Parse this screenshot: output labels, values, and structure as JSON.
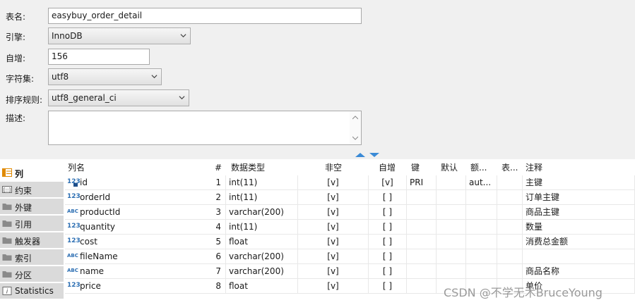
{
  "form": {
    "table_name_label": "表名:",
    "table_name_value": "easybuy_order_detail",
    "engine_label": "引擎:",
    "engine_value": "InnoDB",
    "auto_inc_label": "自增:",
    "auto_inc_value": "156",
    "charset_label": "字符集:",
    "charset_value": "utf8",
    "collation_label": "排序规则:",
    "collation_value": "utf8_general_ci",
    "description_label": "描述:",
    "description_value": ""
  },
  "side_tabs": [
    {
      "label": "列",
      "icon": "columns-icon",
      "active": true
    },
    {
      "label": "约束",
      "icon": "constraint-icon",
      "active": false
    },
    {
      "label": "外键",
      "icon": "folder-icon",
      "active": false
    },
    {
      "label": "引用",
      "icon": "folder-icon",
      "active": false
    },
    {
      "label": "触发器",
      "icon": "folder-icon",
      "active": false
    },
    {
      "label": "索引",
      "icon": "folder-icon",
      "active": false
    },
    {
      "label": "分区",
      "icon": "folder-icon",
      "active": false
    },
    {
      "label": "Statistics",
      "icon": "info-icon",
      "active": false
    }
  ],
  "grid": {
    "headers": {
      "name": "列名",
      "num": "#",
      "type": "数据类型",
      "notnull": "非空",
      "autoinc": "自增",
      "key": "键",
      "default": "默认",
      "extra": "额...",
      "expr": "表...",
      "comment": "注释"
    },
    "rows": [
      {
        "icon": "123",
        "name": "id",
        "num": "1",
        "type": "int(11)",
        "notnull": "[v]",
        "autoinc": "[v]",
        "key": "PRI",
        "default": "",
        "extra": "aut...",
        "expr": "",
        "comment": "主键",
        "pk": true
      },
      {
        "icon": "123",
        "name": "orderId",
        "num": "2",
        "type": "int(11)",
        "notnull": "[v]",
        "autoinc": "[ ]",
        "key": "",
        "default": "",
        "extra": "",
        "expr": "",
        "comment": "订单主键",
        "pk": false
      },
      {
        "icon": "ABC",
        "name": "productId",
        "num": "3",
        "type": "varchar(200)",
        "notnull": "[v]",
        "autoinc": "[ ]",
        "key": "",
        "default": "",
        "extra": "",
        "expr": "",
        "comment": "商品主键",
        "pk": false
      },
      {
        "icon": "123",
        "name": "quantity",
        "num": "4",
        "type": "int(11)",
        "notnull": "[v]",
        "autoinc": "[ ]",
        "key": "",
        "default": "",
        "extra": "",
        "expr": "",
        "comment": "数量",
        "pk": false
      },
      {
        "icon": "123",
        "name": "cost",
        "num": "5",
        "type": "float",
        "notnull": "[v]",
        "autoinc": "[ ]",
        "key": "",
        "default": "",
        "extra": "",
        "expr": "",
        "comment": "消费总金额",
        "pk": false
      },
      {
        "icon": "ABC",
        "name": "fileName",
        "num": "6",
        "type": "varchar(200)",
        "notnull": "[v]",
        "autoinc": "[ ]",
        "key": "",
        "default": "",
        "extra": "",
        "expr": "",
        "comment": "",
        "pk": false
      },
      {
        "icon": "ABC",
        "name": "name",
        "num": "7",
        "type": "varchar(200)",
        "notnull": "[v]",
        "autoinc": "[ ]",
        "key": "",
        "default": "",
        "extra": "",
        "expr": "",
        "comment": "商品名称",
        "pk": false
      },
      {
        "icon": "123",
        "name": "price",
        "num": "8",
        "type": "float",
        "notnull": "[v]",
        "autoinc": "[ ]",
        "key": "",
        "default": "",
        "extra": "",
        "expr": "",
        "comment": "单价",
        "pk": false
      }
    ]
  },
  "watermark": "CSDN @不学无术BruceYoung",
  "colors": {
    "form_bg": "#f0f0f0",
    "tab_bg": "#dadada",
    "numeric_icon": "#2d6fb3",
    "string_icon": "#2d6fb3",
    "tab_icon_orange": "#e08a00",
    "splitter_arrow": "#3a8ad6"
  }
}
